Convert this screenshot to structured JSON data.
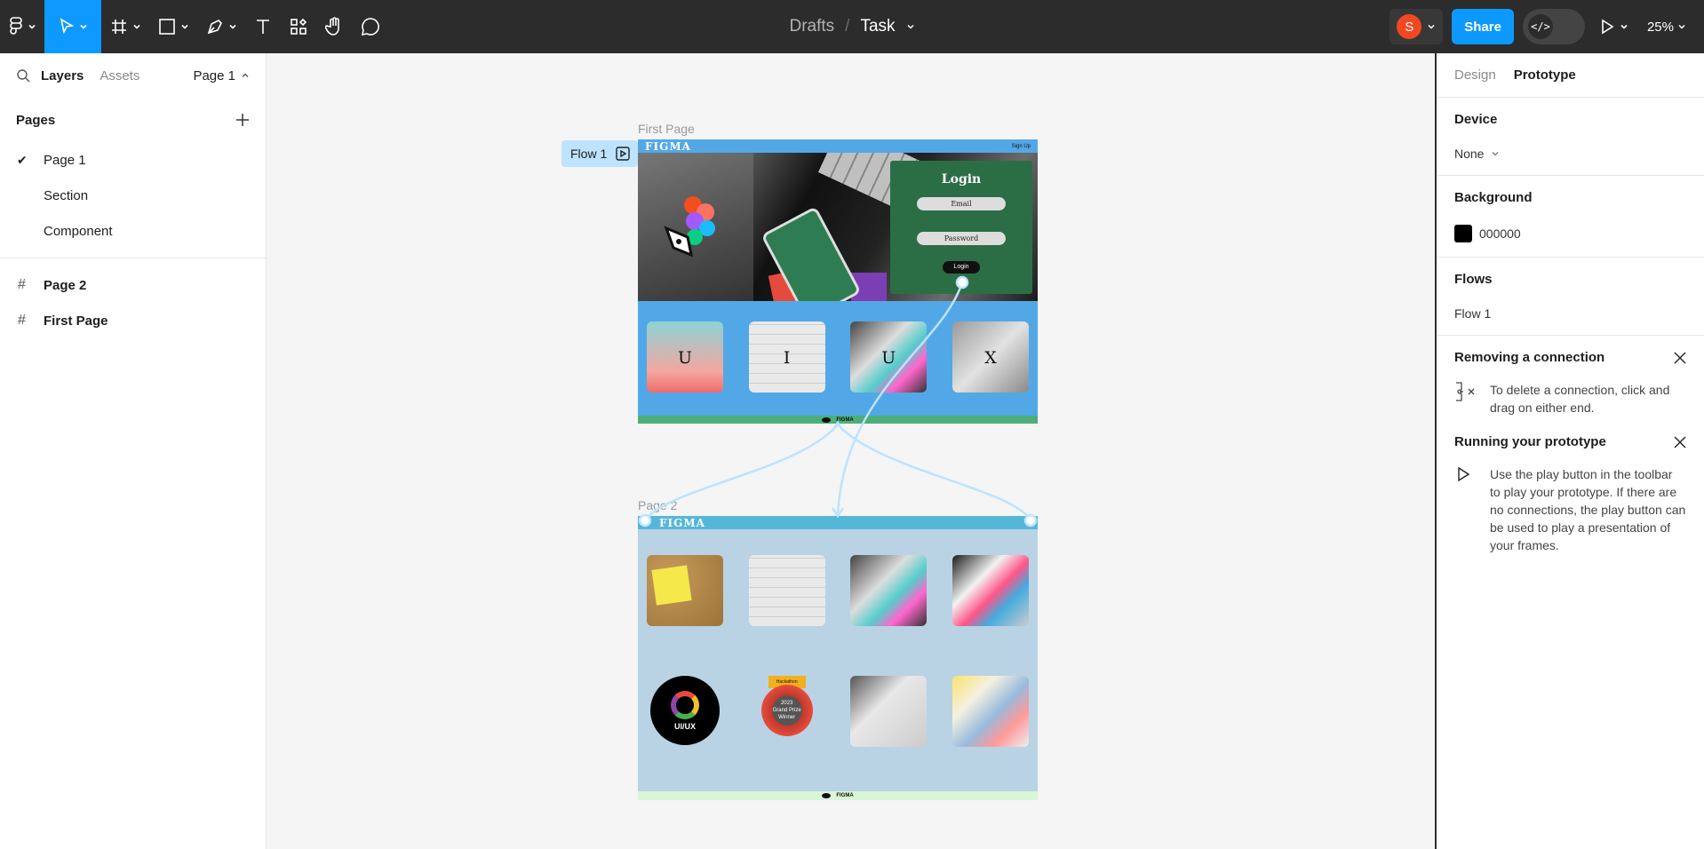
{
  "toolbar": {
    "breadcrumb_parent": "Drafts",
    "breadcrumb_sep": "/",
    "file_name": "Task",
    "avatar_initial": "S",
    "share_label": "Share",
    "zoom_label": "25%",
    "accent": "#0d99ff"
  },
  "left_panel": {
    "tab_layers": "Layers",
    "tab_assets": "Assets",
    "page_selector": "Page 1",
    "pages_heading": "Pages",
    "pages": [
      {
        "label": "Page 1",
        "selected": true
      },
      {
        "label": "Section",
        "selected": false
      },
      {
        "label": "Component",
        "selected": false
      }
    ],
    "layers": [
      {
        "label": "Page 2",
        "icon": "frame-icon"
      },
      {
        "label": "First Page",
        "icon": "frame-icon"
      }
    ]
  },
  "canvas": {
    "frame1_label": "First Page",
    "frame2_label": "Page 2",
    "flow_badge": "Flow 1",
    "frame1": {
      "brand": "FIGMA",
      "signup": "Sign Up",
      "login_title": "Login",
      "email_placeholder": "Email",
      "password_placeholder": "Password",
      "login_button": "Login",
      "cards": [
        "U",
        "I",
        "U",
        "X"
      ],
      "footer_brand": "FIGMA"
    },
    "frame2": {
      "brand": "FIGMA",
      "badge_text": "UI/UX",
      "medal_ribbon": "Hackathon",
      "medal_year": "2023",
      "medal_line1": "Grand Prize",
      "medal_line2": "Winner",
      "footer_brand": "FIGMA"
    }
  },
  "right_panel": {
    "tab_design": "Design",
    "tab_prototype": "Prototype",
    "device_heading": "Device",
    "device_value": "None",
    "background_heading": "Background",
    "background_value": "000000",
    "flows_heading": "Flows",
    "flow_item": "Flow 1",
    "tip1_title": "Removing a connection",
    "tip1_body": "To delete a connection, click and drag on either end.",
    "tip2_title": "Running your prototype",
    "tip2_body": "Use the play button in the toolbar to play your prototype. If there are no connections, the play button can be used to play a presentation of your frames."
  }
}
